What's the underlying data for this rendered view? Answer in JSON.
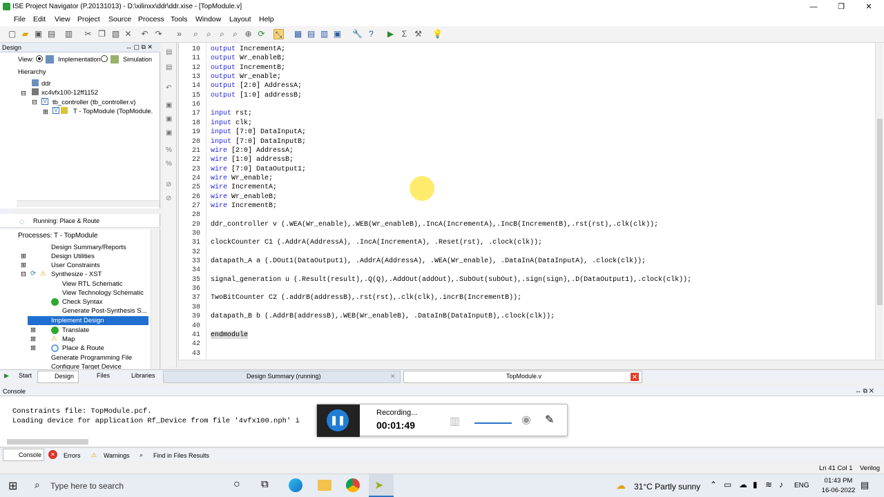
{
  "window": {
    "title": "ISE Project Navigator (P.20131013) - D:\\xilinxx\\ddr\\ddr.xise - [TopModule.v]",
    "minimize": "—",
    "maximize": "❐",
    "close": "✕"
  },
  "menu": [
    "File",
    "Edit",
    "View",
    "Project",
    "Source",
    "Process",
    "Tools",
    "Window",
    "Layout",
    "Help"
  ],
  "design_panel": {
    "title": "Design",
    "view_label": "View:",
    "impl_label": "Implementation",
    "sim_label": "Simulation",
    "hierarchy_label": "Hierarchy",
    "tree": [
      "ddr",
      "xc4vfx100-12ff1152",
      "tb_controller (tb_controller.v)",
      "T - TopModule (TopModule."
    ]
  },
  "running": "Running: Place & Route",
  "processes": {
    "title": "Processes: T - TopModule",
    "items": [
      "Design Summary/Reports",
      "Design Utilities",
      "User Constraints",
      "Synthesize - XST",
      "View RTL Schematic",
      "View Technology Schematic",
      "Check Syntax",
      "Generate Post-Synthesis S...",
      "Implement Design",
      "Translate",
      "Map",
      "Place & Route",
      "Generate Programming File",
      "Configure Target Device"
    ]
  },
  "code": {
    "lines": [
      {
        "n": "10",
        "kw": "output",
        "rest": " IncrementA;"
      },
      {
        "n": "11",
        "kw": "output",
        "rest": " Wr_enableB;"
      },
      {
        "n": "12",
        "kw": "output",
        "rest": " IncrementB;"
      },
      {
        "n": "13",
        "kw": "output",
        "rest": " Wr_enable;"
      },
      {
        "n": "14",
        "kw": "output",
        "rest": " [2:0] AddressA;"
      },
      {
        "n": "15",
        "kw": "output",
        "rest": " [1:0] addressB;"
      },
      {
        "n": "16",
        "kw": "",
        "rest": ""
      },
      {
        "n": "17",
        "kw": "input",
        "rest": " rst;"
      },
      {
        "n": "18",
        "kw": "input",
        "rest": " clk;"
      },
      {
        "n": "19",
        "kw": "input",
        "rest": " [7:0] DataInputA;"
      },
      {
        "n": "20",
        "kw": "input",
        "rest": " [7:0] DataInputB;"
      },
      {
        "n": "21",
        "kw": "wire",
        "rest": " [2:0] AddressA;"
      },
      {
        "n": "22",
        "kw": "wire",
        "rest": " [1:0] addressB;"
      },
      {
        "n": "23",
        "kw": "wire",
        "rest": " [7:0] DataOutput1;"
      },
      {
        "n": "24",
        "kw": "wire",
        "rest": " Wr_enable;"
      },
      {
        "n": "25",
        "kw": "wire",
        "rest": " IncrementA;"
      },
      {
        "n": "26",
        "kw": "wire",
        "rest": " Wr_enableB;"
      },
      {
        "n": "27",
        "kw": "wire",
        "rest": " IncrementB;"
      },
      {
        "n": "28",
        "kw": "",
        "rest": ""
      },
      {
        "n": "29",
        "kw": "",
        "rest": "ddr_controller v (.WEA(Wr_enable),.WEB(Wr_enableB),.IncA(IncrementA),.IncB(IncrementB),.rst(rst),.clk(clk));"
      },
      {
        "n": "30",
        "kw": "",
        "rest": ""
      },
      {
        "n": "31",
        "kw": "",
        "rest": "clockCounter C1 (.AddrA(AddressA), .IncA(IncrementA), .Reset(rst), .clock(clk));"
      },
      {
        "n": "32",
        "kw": "",
        "rest": ""
      },
      {
        "n": "33",
        "kw": "",
        "rest": "datapath_A a (.DOut1(DataOutput1), .AddrA(AddressA), .WEA(Wr_enable), .DataInA(DataInputA), .clock(clk));"
      },
      {
        "n": "34",
        "kw": "",
        "rest": ""
      },
      {
        "n": "35",
        "kw": "",
        "rest": "signal_generation u (.Result(result),.Q(Q),.AddOut(addOut),.SubOut(subOut),.sign(sign),.D(DataOutput1),.clock(clk));"
      },
      {
        "n": "36",
        "kw": "",
        "rest": ""
      },
      {
        "n": "37",
        "kw": "",
        "rest": "TwoBitCounter C2 (.addrB(addressB),.rst(rst),.clk(clk),.incrB(IncrementB));"
      },
      {
        "n": "38",
        "kw": "",
        "rest": ""
      },
      {
        "n": "39",
        "kw": "",
        "rest": "datapath_B b (.AddrB(addressB),.WEB(Wr_enableB), .DataInB(DataInputB),.clock(clk));"
      },
      {
        "n": "40",
        "kw": "",
        "rest": ""
      },
      {
        "n": "41",
        "kw": "",
        "rest": "endmodule"
      },
      {
        "n": "42",
        "kw": "",
        "rest": ""
      },
      {
        "n": "43",
        "kw": "",
        "rest": ""
      }
    ]
  },
  "bottom_tabs": {
    "start": "Start",
    "design": "Design",
    "files": "Files",
    "libraries": "Libraries",
    "summary": "Design Summary (running)",
    "topmodule": "TopModule.v"
  },
  "console": {
    "title": "Console",
    "lines": [
      "Constraints file: TopModule.pcf.",
      "Loading device for application Rf_Device from file '4vfx100.nph' i"
    ]
  },
  "console_tabs": {
    "console": "Console",
    "errors": "Errors",
    "warnings": "Warnings",
    "find": "Find in Files Results"
  },
  "status": {
    "position": "Ln 41 Col 1",
    "lang": "Verilog"
  },
  "recorder": {
    "label": "Recording...",
    "time": "00:01:49"
  },
  "taskbar": {
    "search": "Type here to search",
    "weather": "31°C  Partly sunny",
    "lang": "ENG",
    "time": "01:43 PM",
    "date": "16-06-2022"
  }
}
